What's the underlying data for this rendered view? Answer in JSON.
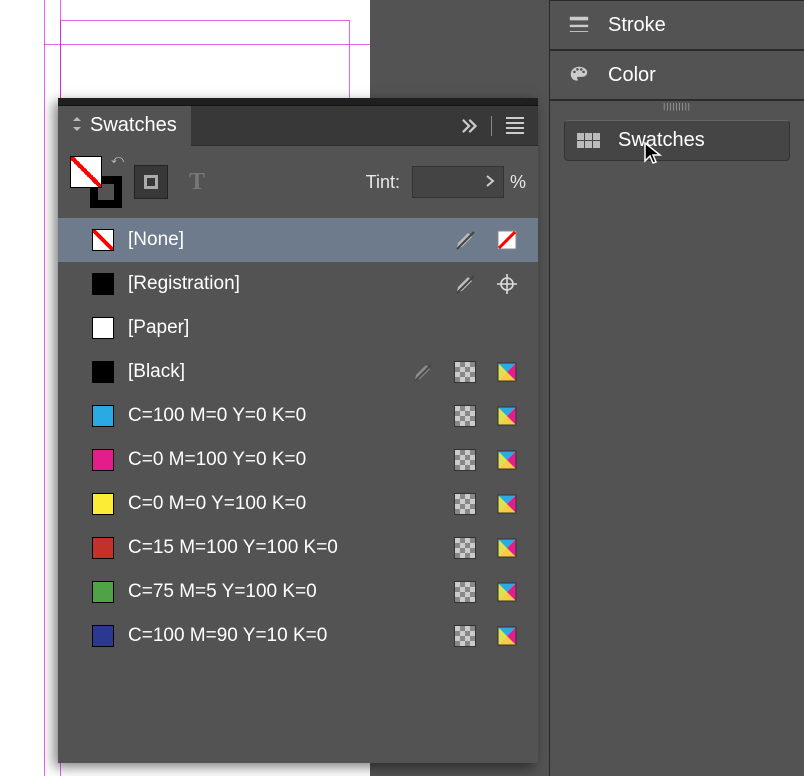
{
  "rightDock": {
    "stroke": {
      "label": "Stroke"
    },
    "color": {
      "label": "Color"
    },
    "swatches": {
      "label": "Swatches"
    }
  },
  "panel": {
    "title": "Swatches",
    "tint_label": "Tint:",
    "tint_value": "",
    "tint_unit": "%",
    "format_text_glyph": "T"
  },
  "swatches": [
    {
      "name": "[None]",
      "chip": "none",
      "color": "#ffffff",
      "noedit": true,
      "mode": "none",
      "selected": true
    },
    {
      "name": "[Registration]",
      "chip": "solid",
      "color": "#000000",
      "noedit": true,
      "mode": "reg",
      "selected": false
    },
    {
      "name": "[Paper]",
      "chip": "solid",
      "color": "#ffffff",
      "noedit": false,
      "mode": "",
      "selected": false
    },
    {
      "name": "[Black]",
      "chip": "solid",
      "color": "#000000",
      "noedit": true,
      "mode": "cmyk",
      "global": true,
      "selected": false
    },
    {
      "name": "C=100 M=0 Y=0 K=0",
      "chip": "solid",
      "color": "#2aaae2",
      "mode": "cmyk",
      "global": true,
      "selected": false
    },
    {
      "name": "C=0 M=100 Y=0 K=0",
      "chip": "solid",
      "color": "#e31d8c",
      "mode": "cmyk",
      "global": true,
      "selected": false
    },
    {
      "name": "C=0 M=0 Y=100 K=0",
      "chip": "solid",
      "color": "#fbec36",
      "mode": "cmyk",
      "global": true,
      "selected": false
    },
    {
      "name": "C=15 M=100 Y=100 K=0",
      "chip": "solid",
      "color": "#c4312b",
      "mode": "cmyk",
      "global": true,
      "selected": false
    },
    {
      "name": "C=75 M=5 Y=100 K=0",
      "chip": "solid",
      "color": "#4fa245",
      "mode": "cmyk",
      "global": true,
      "selected": false
    },
    {
      "name": "C=100 M=90 Y=10 K=0",
      "chip": "solid",
      "color": "#2a3890",
      "mode": "cmyk",
      "global": true,
      "selected": false
    }
  ]
}
